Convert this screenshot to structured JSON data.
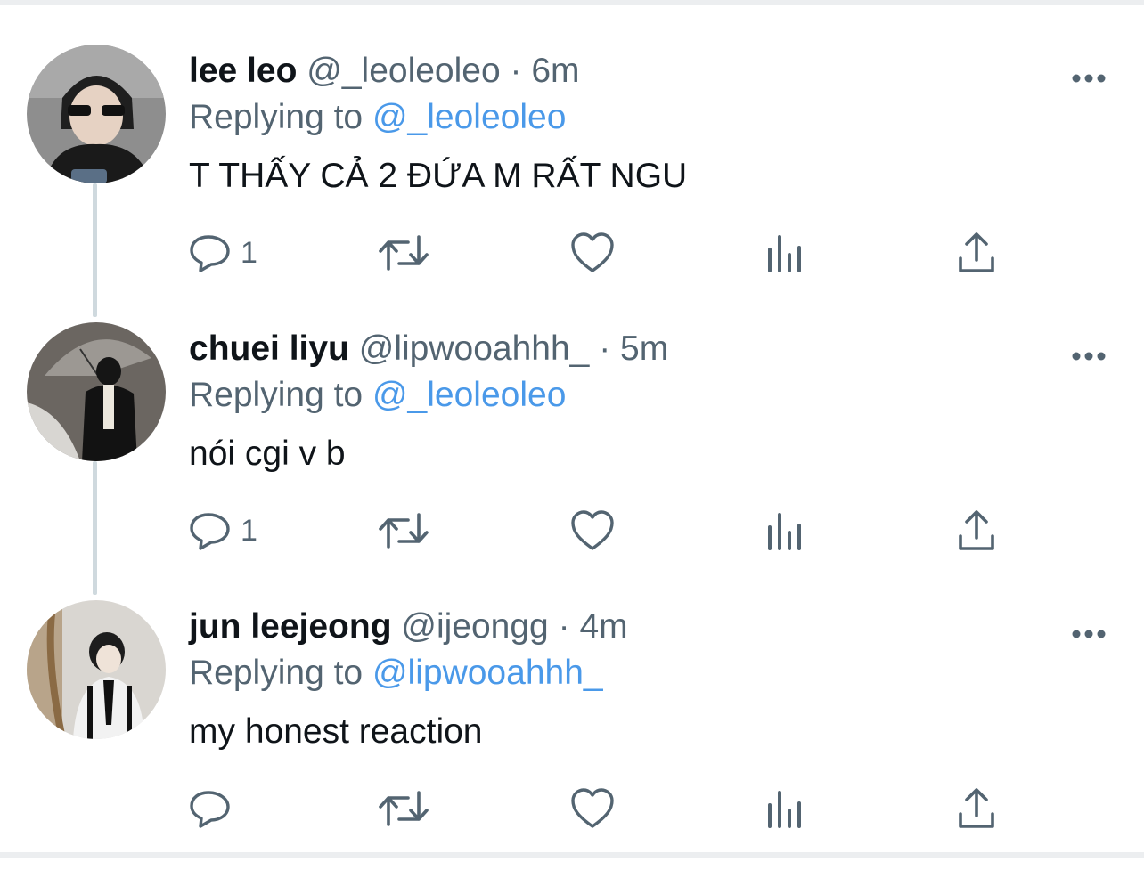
{
  "tweets": [
    {
      "name": "lee leo",
      "handle": "@_leoleoleo",
      "separator": "·",
      "time": "6m",
      "replying_label": "Replying to",
      "replying_to": "@_leoleoleo",
      "text": "T THẤY CẢ 2 ĐỨA M RẤT NGU",
      "reply_count": "1"
    },
    {
      "name": "chuei liyu",
      "handle": "@lipwooahhh_",
      "separator": "·",
      "time": "5m",
      "replying_label": "Replying to",
      "replying_to": "@_leoleoleo",
      "text": "nói cgi v b",
      "reply_count": "1"
    },
    {
      "name": "jun leejeong",
      "handle": "@ijeongg",
      "separator": "·",
      "time": "4m",
      "replying_label": "Replying to",
      "replying_to": "@lipwooahhh_",
      "text": "my honest reaction",
      "reply_count": ""
    }
  ],
  "icons": {
    "reply": "reply-icon",
    "retweet": "retweet-icon",
    "like": "heart-icon",
    "views": "views-icon",
    "share": "share-icon",
    "more": "more-icon"
  },
  "colors": {
    "text": "#0f1419",
    "secondary": "#536471",
    "mention": "#4a99e9",
    "thread_line": "#cfd9de"
  }
}
